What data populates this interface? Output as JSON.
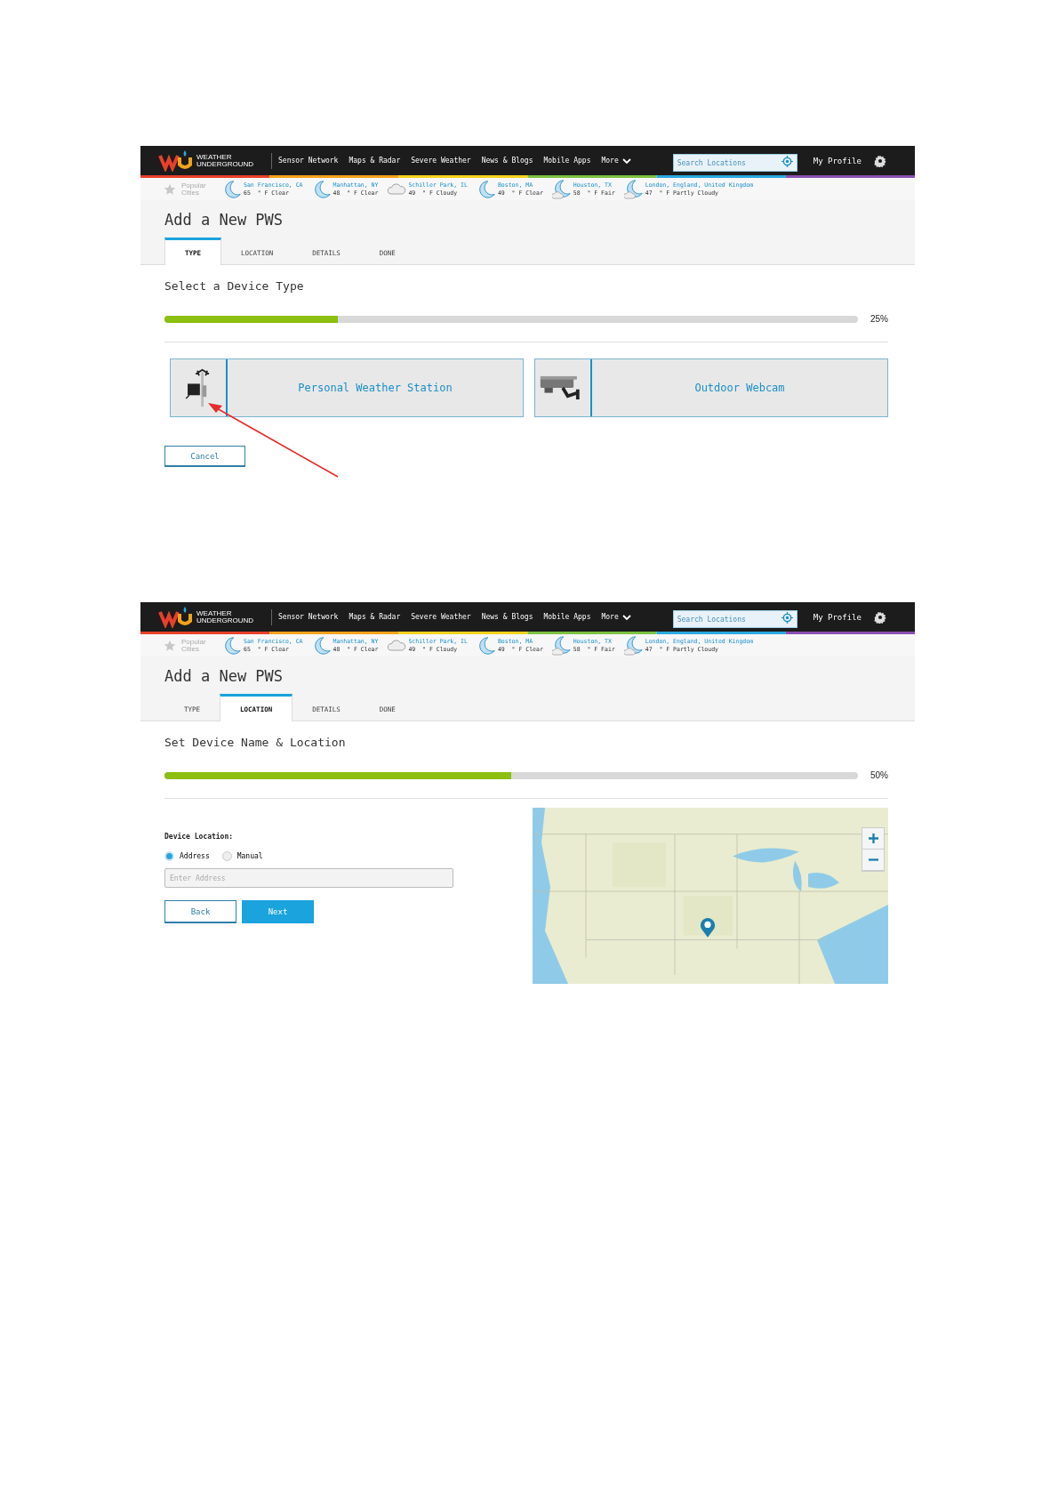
{
  "screens": [
    {
      "nav": {
        "logo_text": "WEATHER UNDERGROUND",
        "links": [
          "Sensor Network",
          "Maps & Radar",
          "Severe Weather",
          "News & Blogs",
          "Mobile Apps",
          "More"
        ],
        "search": {
          "placeholder": "Search Locations"
        },
        "profile": "My Profile"
      },
      "cities": {
        "label": "Popular Cities",
        "items": [
          {
            "name": "San Francisco, CA",
            "reading": "65  ° F Clear",
            "kind": "clear"
          },
          {
            "name": "Manhattan, NY",
            "reading": "48  ° F Clear",
            "kind": "clear"
          },
          {
            "name": "Schiller Park, IL",
            "reading": "49  ° F Cloudy",
            "kind": "cloudy"
          },
          {
            "name": "Boston, MA",
            "reading": "49  ° F Clear",
            "kind": "clear"
          },
          {
            "name": "Houston, TX",
            "reading": "58  ° F Fair",
            "kind": "partly"
          },
          {
            "name": "London, England, United Kingdom",
            "reading": "47  ° F Partly Cloudy",
            "kind": "partly"
          }
        ]
      },
      "title": "Add a New PWS",
      "tabs": [
        {
          "label": "TYPE",
          "selected": true
        },
        {
          "label": "LOCATION",
          "selected": false
        },
        {
          "label": "DETAILS",
          "selected": false
        },
        {
          "label": "DONE",
          "selected": false
        }
      ],
      "step_title": "Select a Device Type",
      "progress": {
        "level": 0.25,
        "reading": "25%"
      },
      "body": {
        "kind": "device_types",
        "options": [
          {
            "label": "Personal Weather Station",
            "kind": "station"
          },
          {
            "label": "Outdoor Webcam",
            "kind": "webcam"
          }
        ],
        "cancel": "Cancel"
      }
    },
    {
      "nav": {
        "logo_text": "WEATHER UNDERGROUND",
        "links": [
          "Sensor Network",
          "Maps & Radar",
          "Severe Weather",
          "News & Blogs",
          "Mobile Apps",
          "More"
        ],
        "search": {
          "placeholder": "Search Locations"
        },
        "profile": "My Profile"
      },
      "cities": {
        "label": "Popular Cities",
        "items": [
          {
            "name": "San Francisco, CA",
            "reading": "65  ° F Clear",
            "kind": "clear"
          },
          {
            "name": "Manhattan, NY",
            "reading": "48  ° F Clear",
            "kind": "clear"
          },
          {
            "name": "Schiller Park, IL",
            "reading": "49  ° F Cloudy",
            "kind": "cloudy"
          },
          {
            "name": "Boston, MA",
            "reading": "49  ° F Clear",
            "kind": "clear"
          },
          {
            "name": "Houston, TX",
            "reading": "58  ° F Fair",
            "kind": "partly"
          },
          {
            "name": "London, England, United Kingdom",
            "reading": "47  ° F Partly Cloudy",
            "kind": "partly"
          }
        ]
      },
      "title": "Add a New PWS",
      "tabs": [
        {
          "label": "TYPE",
          "selected": false
        },
        {
          "label": "LOCATION",
          "selected": true
        },
        {
          "label": "DETAILS",
          "selected": false
        },
        {
          "label": "DONE",
          "selected": false
        }
      ],
      "step_title": "Set Device Name & Location",
      "progress": {
        "level": 0.5,
        "reading": "50%"
      },
      "body": {
        "kind": "location",
        "heading": "Device Location:",
        "radios": [
          {
            "label": "Address",
            "selected": true
          },
          {
            "label": "Manual",
            "selected": false
          }
        ],
        "address": {
          "placeholder": "Enter Address"
        },
        "back": "Back",
        "next": "Next"
      }
    }
  ]
}
